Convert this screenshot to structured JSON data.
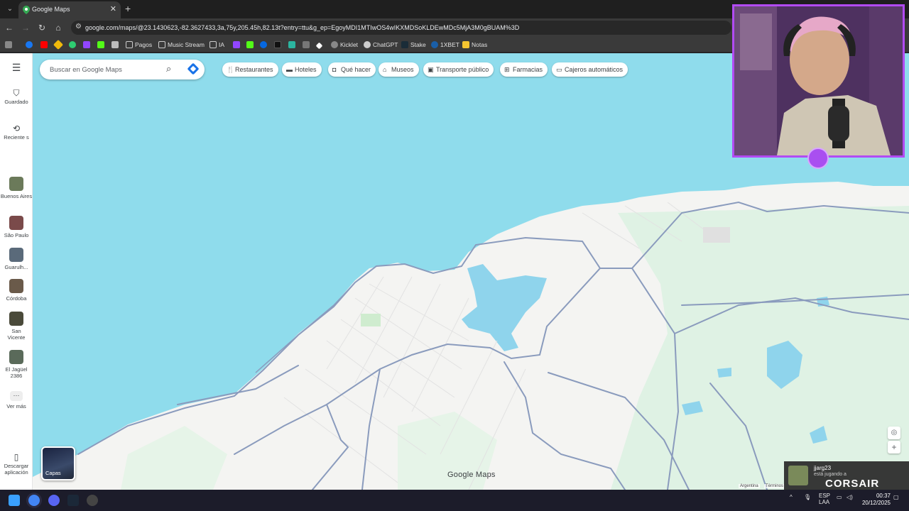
{
  "browser": {
    "tab_title": "Google Maps",
    "url": "google.com/maps/@23.1430623,-82.3627433,3a,75y,205.45h,82.13t?entry=ttu&g_ep=EgoyMDI1MTIwOS4wIKXMDSoKLDEwMDc5MjA3M0gBUAM%3D",
    "bookmarks": [
      "Pagos",
      "Music Stream",
      "IA",
      "Kicklet",
      "ChatGPT",
      "Stake",
      "1XBET",
      "Notas"
    ]
  },
  "search": {
    "placeholder": "Buscar en Google Maps"
  },
  "chips": [
    "Restaurantes",
    "Hoteles",
    "Qué hacer",
    "Museos",
    "Transporte público",
    "Farmacias",
    "Cajeros automáticos"
  ],
  "rail": {
    "saved": "Guardado",
    "recents": "Reciente s",
    "places": [
      {
        "label": "Buenos Aires",
        "color": "#6b7a5a"
      },
      {
        "label": "São Paulo",
        "color": "#7a4a4a"
      },
      {
        "label": "Guarulh...",
        "color": "#5a6a7a"
      },
      {
        "label": "Córdoba",
        "color": "#6a5a4a"
      },
      {
        "label": "San Vicente",
        "color": "#4a4a3a"
      },
      {
        "label": "El Jagüel 2386",
        "color": "#5a6a5a"
      }
    ],
    "more": "Ver más",
    "download": "Descargar aplicación"
  },
  "map": {
    "brand": "Google Maps",
    "layers_label": "Capas",
    "footer_region": "Argentina",
    "footer_terms": "Términos",
    "colors": {
      "sea": "#8fdcec",
      "land": "#f4f4f2",
      "green": "#dff2e4",
      "road": "#8a9bbd",
      "water_inland": "#8fd4ec"
    }
  },
  "overlay": {
    "user": "jjarg23",
    "status": "está jugando a",
    "brand": "CORSAIR"
  },
  "taskbar": {
    "lang_top": "ESP",
    "lang_bottom": "LAA",
    "time": "00:37",
    "date": "20/12/2025"
  }
}
